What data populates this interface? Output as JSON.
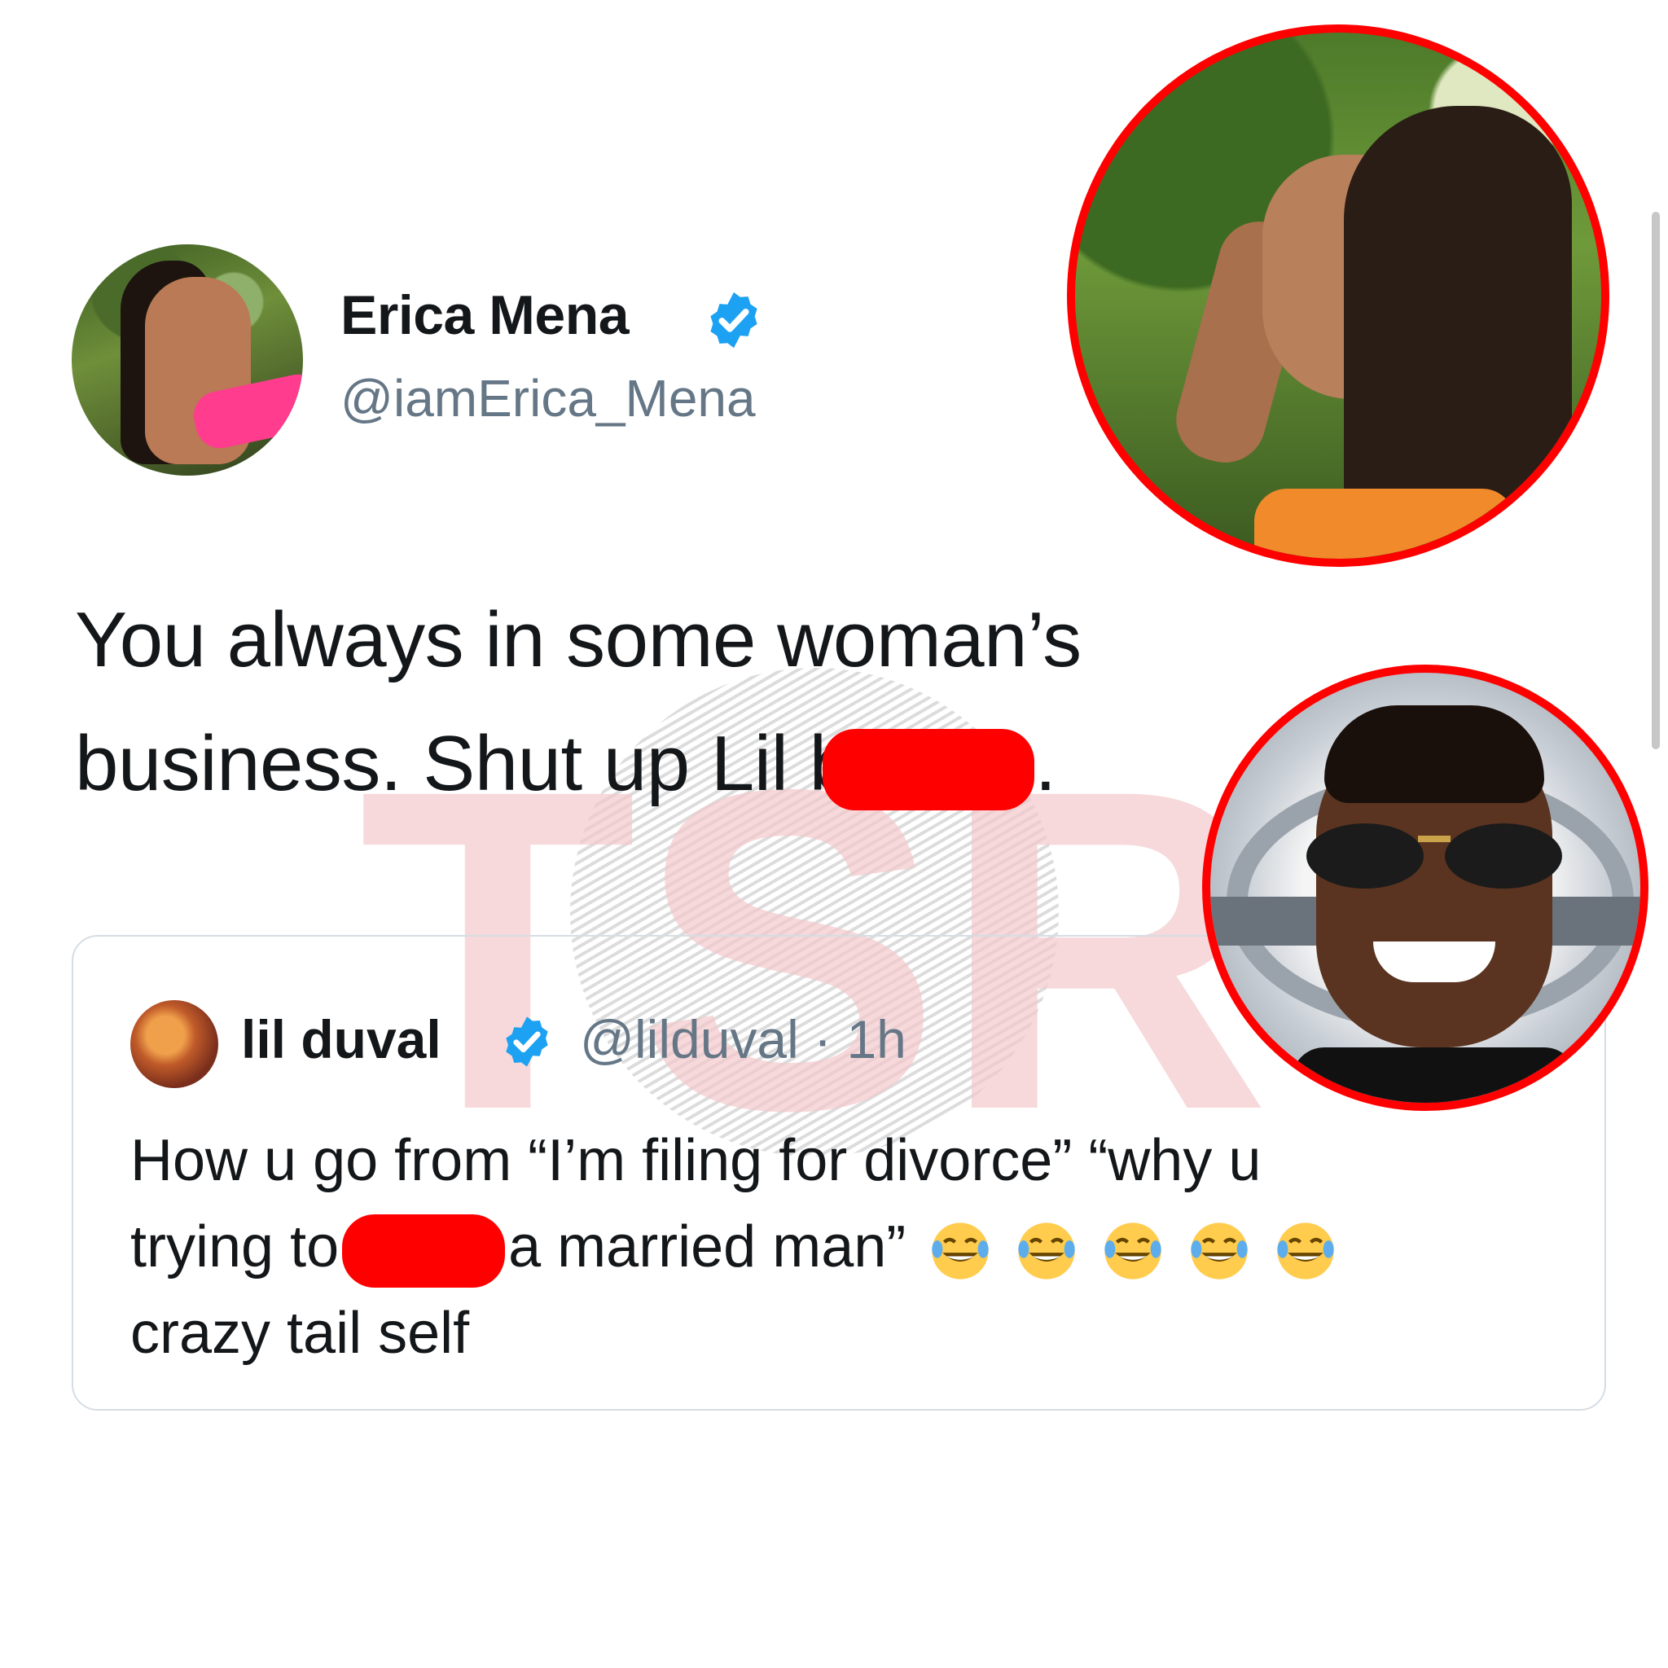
{
  "tweet": {
    "author_name": "Erica Mena",
    "author_handle": "@iamErica_Mena",
    "text_line1": "You always in some woman’s",
    "text_line2_before": "business. Shut up Lil b",
    "text_line2_after": ".",
    "verified_icon": "verified-badge-icon"
  },
  "quoted_tweet": {
    "author_name": "lil duval",
    "author_handle": "@lilduval",
    "separator": "·",
    "time": "1h",
    "text_line1": "How u go from “I’m filing for divorce” “why u",
    "text_line2_before": "trying to",
    "text_line2_after": "a married man”",
    "text_line3": "crazy tail self",
    "emoji_name": "face-with-tears-of-joy",
    "emoji_count": 5
  },
  "watermark": {
    "text": "TSR"
  },
  "colors": {
    "highlight_ring": "#ff0000",
    "verified_blue": "#1da1f2",
    "handle_gray": "#657786",
    "watermark_pink": "#f4c9cc"
  }
}
